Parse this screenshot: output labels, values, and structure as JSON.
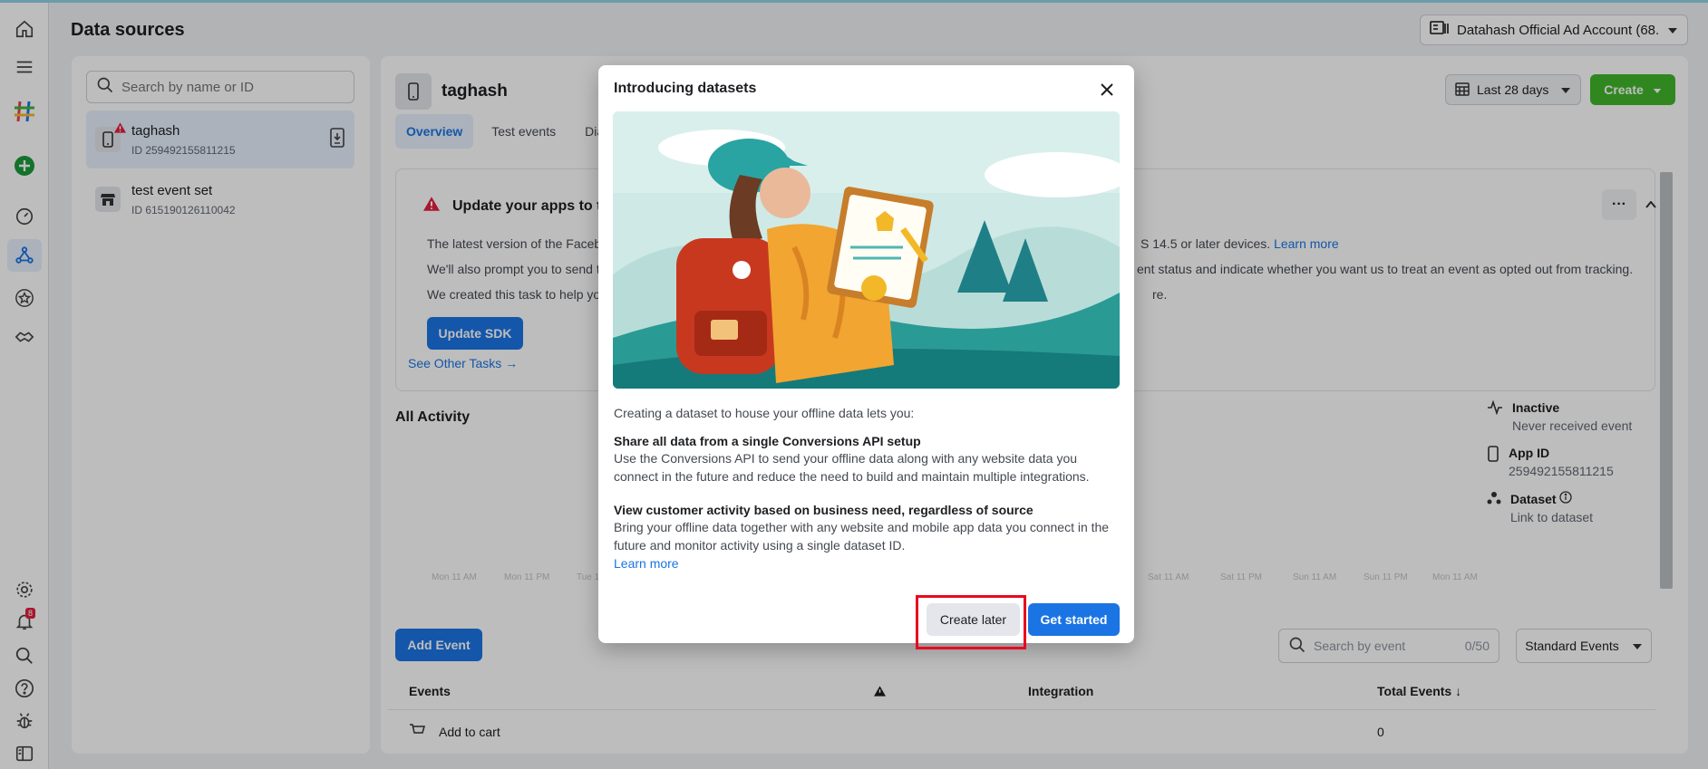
{
  "header": {
    "title": "Data sources",
    "account_selector": "Datahash Official Ad Account (68..."
  },
  "left_panel": {
    "search_placeholder": "Search by name or ID",
    "items": [
      {
        "name": "taghash",
        "id": "ID 259492155811215"
      },
      {
        "name": "test event set",
        "id": "ID 615190126110042"
      }
    ]
  },
  "main": {
    "title": "taghash",
    "tabs": [
      {
        "label": "Overview"
      },
      {
        "label": "Test events"
      },
      {
        "label": "Dia"
      }
    ],
    "date_range": "Last 28 days",
    "create_label": "Create",
    "update_card": {
      "title": "Update your apps to the lat",
      "line1": "The latest version of the Faceb",
      "line1_right": "S 14.5 or later devices.",
      "learn_more": "Learn more",
      "line2": "We'll also prompt you to send t",
      "line2_right": "ent status and indicate whether you want us to treat an event as opted out from tracking.",
      "line3": "We created this task to help yo",
      "line3_right": "re.",
      "button": "Update SDK",
      "other_tasks": "See Other Tasks →"
    },
    "all_activity": "All Activity",
    "x_ticks_left": [
      "Mon 11 AM",
      "Mon 11 PM",
      "Tue 1"
    ],
    "x_ticks_right": [
      "Sat 11 AM",
      "Sat 11 PM",
      "Sun 11 AM",
      "Sun 11 PM",
      "Mon 11 AM"
    ],
    "side_info": {
      "status_label": "Inactive",
      "status_sub": "Never received event",
      "app_id_label": "App ID",
      "app_id_value": "259492155811215",
      "dataset_label": "Dataset",
      "dataset_link": "Link to dataset"
    },
    "add_event": "Add Event",
    "event_search_placeholder": "Search by event",
    "event_count": "0/50",
    "standard_events": "Standard Events",
    "table": {
      "columns": [
        "Events",
        "Integration",
        "Total Events ↓"
      ],
      "rows": [
        {
          "event": "Add to cart",
          "total": "0"
        }
      ]
    }
  },
  "rail": {
    "notification_count": "8"
  },
  "modal": {
    "title": "Introducing datasets",
    "intro": "Creating a dataset to house your offline data lets you:",
    "h1": "Share all data from a single Conversions API setup",
    "p1": "Use the Conversions API to send your offline data along with any website data you connect in the future and reduce the need to build and maintain multiple integrations.",
    "h2": "View customer activity based on business need, regardless of source",
    "p2": "Bring your offline data together with any website and mobile app data you connect in the future and monitor activity using a single dataset ID.",
    "learn_more": "Learn more",
    "create_later": "Create later",
    "get_started": "Get started"
  },
  "colors": {
    "accent": "#1b74e4",
    "create_green": "#42b72a",
    "highlight_red": "#e8091e"
  }
}
